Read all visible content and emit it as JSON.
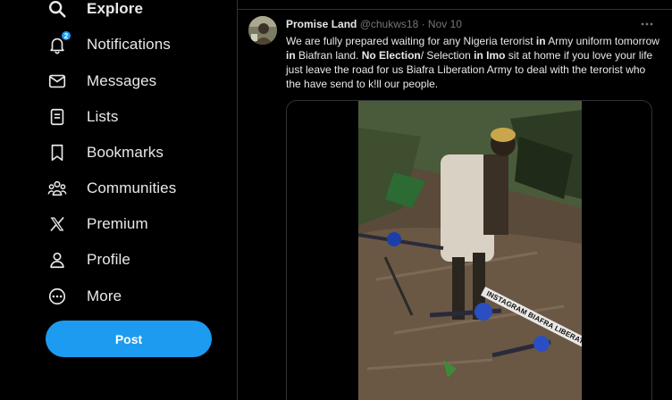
{
  "sidebar": {
    "items": [
      {
        "label": "Explore",
        "icon": "search-icon",
        "active": true
      },
      {
        "label": "Notifications",
        "icon": "bell-icon",
        "badge": "2"
      },
      {
        "label": "Messages",
        "icon": "envelope-icon"
      },
      {
        "label": "Lists",
        "icon": "list-icon"
      },
      {
        "label": "Bookmarks",
        "icon": "bookmark-icon"
      },
      {
        "label": "Communities",
        "icon": "people-icon"
      },
      {
        "label": "Premium",
        "icon": "x-logo-icon"
      },
      {
        "label": "Profile",
        "icon": "person-icon"
      },
      {
        "label": "More",
        "icon": "more-circle-icon"
      }
    ],
    "post_label": "Post"
  },
  "tweet": {
    "author_name": "Promise Land",
    "handle": "@chukws18",
    "separator": " · ",
    "date": "Nov 10",
    "text_segments": [
      {
        "t": "We are fully prepared waiting for any Nigeria terorist ",
        "b": false
      },
      {
        "t": "in",
        "b": true
      },
      {
        "t": " Army uniform tomorrow ",
        "b": false
      },
      {
        "t": "in",
        "b": true
      },
      {
        "t": " Biafran land. ",
        "b": false
      },
      {
        "t": "No Election",
        "b": true
      },
      {
        "t": "/ Selection ",
        "b": false
      },
      {
        "t": "in Imo",
        "b": true
      },
      {
        "t": " sit at home if you love your life just leave the road for us Biafra Liberation Army to deal with the terorist who the have send to k!ll our people.",
        "b": false
      }
    ],
    "media": {
      "caption": "INSTAGRAM BIAFRA LIBERATION ARMY"
    }
  },
  "colors": {
    "accent": "#1d9bf0",
    "background": "#000000",
    "text": "#e7e9ea",
    "muted": "#71767b",
    "border": "#2f3336"
  }
}
